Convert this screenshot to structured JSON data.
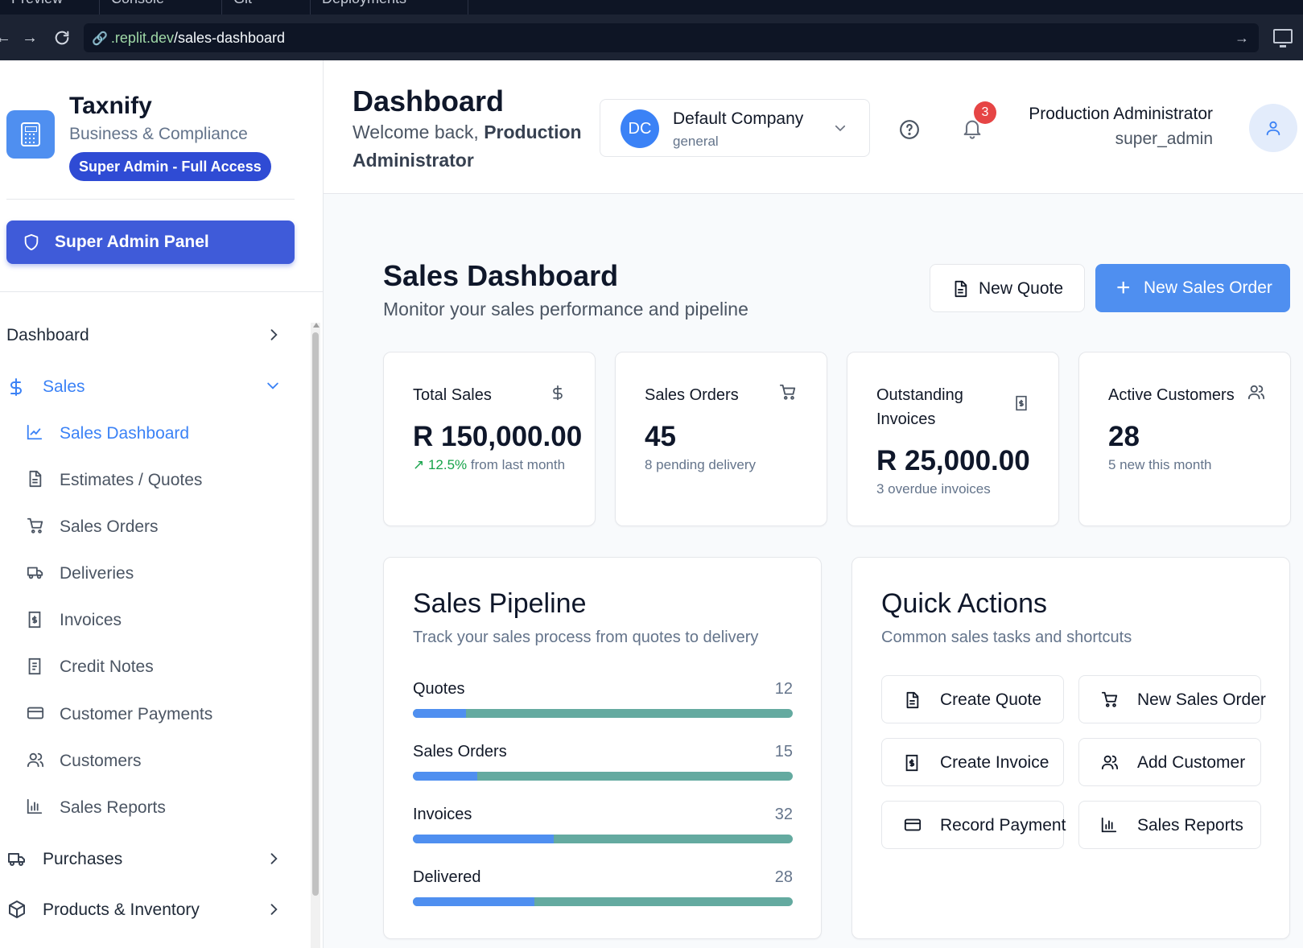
{
  "browser": {
    "tabs": [
      "Preview",
      "Console",
      "Git",
      "Deployments"
    ],
    "url_host": ".replit.dev",
    "url_path": "/sales-dashboard"
  },
  "sidebar": {
    "brand_name": "Taxnify",
    "brand_sub": "Business & Compliance",
    "access_badge": "Super Admin - Full Access",
    "admin_panel_label": "Super Admin Panel",
    "nav_dashboard": "Dashboard",
    "nav_sales": "Sales",
    "sales_items": [
      {
        "label": "Sales Dashboard",
        "icon": "line-chart-icon"
      },
      {
        "label": "Estimates / Quotes",
        "icon": "file-text-icon"
      },
      {
        "label": "Sales Orders",
        "icon": "cart-icon"
      },
      {
        "label": "Deliveries",
        "icon": "truck-icon"
      },
      {
        "label": "Invoices",
        "icon": "invoice-icon"
      },
      {
        "label": "Credit Notes",
        "icon": "receipt-icon"
      },
      {
        "label": "Customer Payments",
        "icon": "credit-card-icon"
      },
      {
        "label": "Customers",
        "icon": "users-icon"
      },
      {
        "label": "Sales Reports",
        "icon": "bar-chart-icon"
      }
    ],
    "nav_purchases": "Purchases",
    "nav_products": "Products & Inventory"
  },
  "header": {
    "title": "Dashboard",
    "welcome_prefix": "Welcome back, ",
    "welcome_name": "Production Administrator",
    "company_initials": "DC",
    "company_name": "Default Company",
    "company_type": "general",
    "notification_count": "3",
    "user_name": "Production Administrator",
    "user_role": "super_admin"
  },
  "main": {
    "title": "Sales Dashboard",
    "subtitle": "Monitor your sales performance and pipeline",
    "new_quote_label": "New Quote",
    "new_order_label": "New Sales Order",
    "stats": [
      {
        "label": "Total Sales",
        "value": "R 150,000.00",
        "trend": "12.5%",
        "note": " from last month"
      },
      {
        "label": "Sales Orders",
        "value": "45",
        "note": "8 pending delivery"
      },
      {
        "label": "Outstanding Invoices",
        "value": "R 25,000.00",
        "note": "3 overdue invoices"
      },
      {
        "label": "Active Customers",
        "value": "28",
        "note": "5 new this month"
      }
    ],
    "pipeline": {
      "title": "Sales Pipeline",
      "subtitle": "Track your sales process from quotes to delivery",
      "rows": [
        {
          "label": "Quotes",
          "value": "12",
          "fill": 0.14
        },
        {
          "label": "Sales Orders",
          "value": "15",
          "fill": 0.17
        },
        {
          "label": "Invoices",
          "value": "32",
          "fill": 0.37
        },
        {
          "label": "Delivered",
          "value": "28",
          "fill": 0.32
        }
      ]
    },
    "quick_actions": {
      "title": "Quick Actions",
      "subtitle": "Common sales tasks and shortcuts",
      "items": [
        "Create Quote",
        "New Sales Order",
        "Create Invoice",
        "Add Customer",
        "Record Payment",
        "Sales Reports"
      ]
    }
  },
  "colors": {
    "accent": "#3b82f6",
    "admin_button": "#3f5bd9",
    "pipeline_track": "#64aaa0",
    "notification_badge": "#e64545"
  }
}
